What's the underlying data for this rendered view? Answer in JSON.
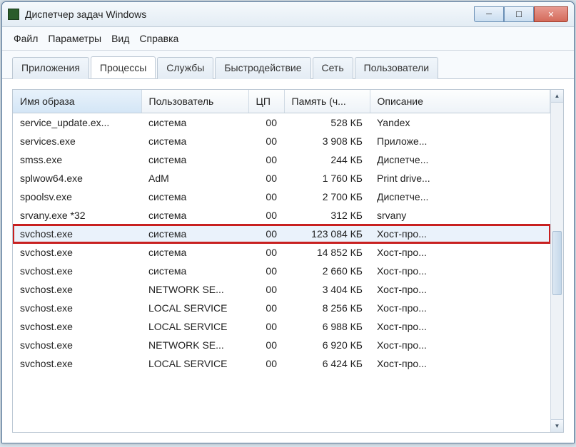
{
  "window": {
    "title": "Диспетчер задач Windows"
  },
  "menu": {
    "file": "Файл",
    "options": "Параметры",
    "view": "Вид",
    "help": "Справка"
  },
  "tabs": {
    "applications": "Приложения",
    "processes": "Процессы",
    "services": "Службы",
    "performance": "Быстродействие",
    "network": "Сеть",
    "users": "Пользователи"
  },
  "columns": {
    "image": "Имя образа",
    "user": "Пользователь",
    "cpu": "ЦП",
    "memory": "Память (ч...",
    "description": "Описание"
  },
  "rows": [
    {
      "image": "service_update.ex...",
      "user": "система",
      "cpu": "00",
      "memory": "528 КБ",
      "desc": "Yandex"
    },
    {
      "image": "services.exe",
      "user": "система",
      "cpu": "00",
      "memory": "3 908 КБ",
      "desc": "Приложе..."
    },
    {
      "image": "smss.exe",
      "user": "система",
      "cpu": "00",
      "memory": "244 КБ",
      "desc": "Диспетче..."
    },
    {
      "image": "splwow64.exe",
      "user": "AdM",
      "cpu": "00",
      "memory": "1 760 КБ",
      "desc": "Print drive..."
    },
    {
      "image": "spoolsv.exe",
      "user": "система",
      "cpu": "00",
      "memory": "2 700 КБ",
      "desc": "Диспетче..."
    },
    {
      "image": "srvany.exe *32",
      "user": "система",
      "cpu": "00",
      "memory": "312 КБ",
      "desc": "srvany"
    },
    {
      "image": "svchost.exe",
      "user": "система",
      "cpu": "00",
      "memory": "123 084 КБ",
      "desc": "Хост-про..."
    },
    {
      "image": "svchost.exe",
      "user": "система",
      "cpu": "00",
      "memory": "14 852 КБ",
      "desc": "Хост-про..."
    },
    {
      "image": "svchost.exe",
      "user": "система",
      "cpu": "00",
      "memory": "2 660 КБ",
      "desc": "Хост-про..."
    },
    {
      "image": "svchost.exe",
      "user": "NETWORK SE...",
      "cpu": "00",
      "memory": "3 404 КБ",
      "desc": "Хост-про..."
    },
    {
      "image": "svchost.exe",
      "user": "LOCAL SERVICE",
      "cpu": "00",
      "memory": "8 256 КБ",
      "desc": "Хост-про..."
    },
    {
      "image": "svchost.exe",
      "user": "LOCAL SERVICE",
      "cpu": "00",
      "memory": "6 988 КБ",
      "desc": "Хост-про..."
    },
    {
      "image": "svchost.exe",
      "user": "NETWORK SE...",
      "cpu": "00",
      "memory": "6 920 КБ",
      "desc": "Хост-про..."
    },
    {
      "image": "svchost.exe",
      "user": "LOCAL SERVICE",
      "cpu": "00",
      "memory": "6 424 КБ",
      "desc": "Хост-про..."
    }
  ],
  "highlighted_row_index": 6
}
